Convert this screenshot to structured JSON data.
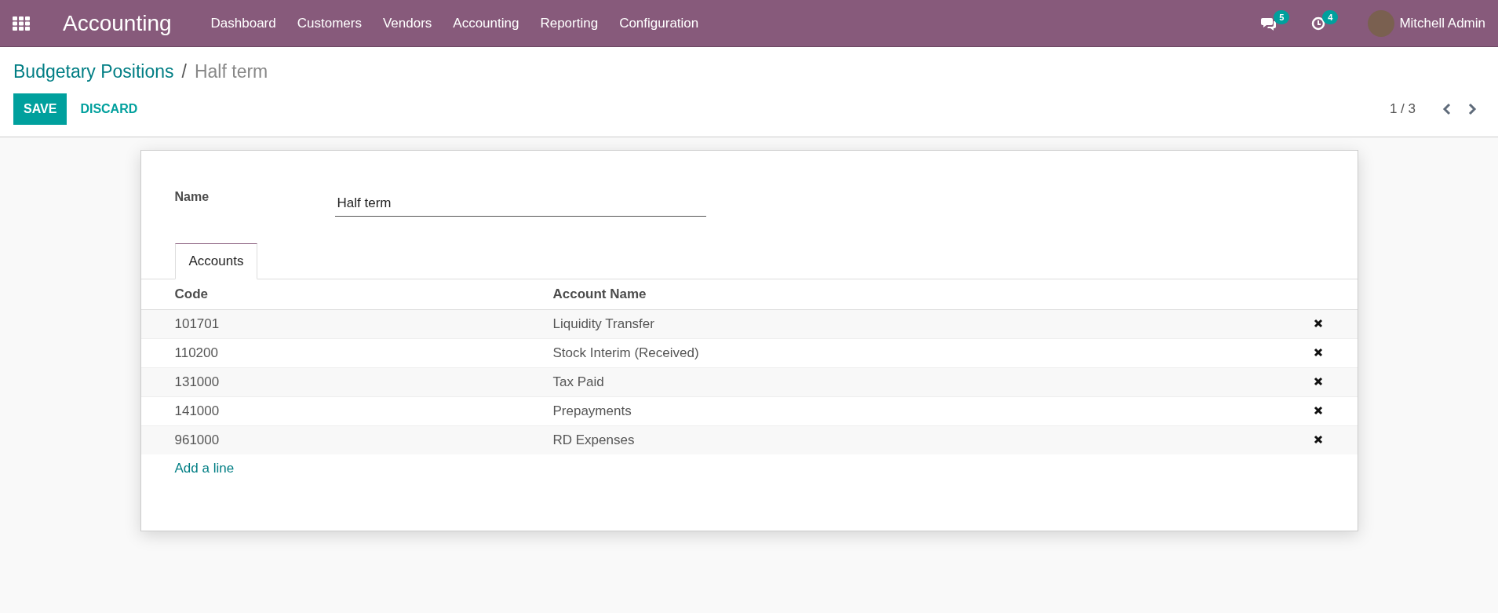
{
  "app": {
    "title": "Accounting"
  },
  "menu": [
    "Dashboard",
    "Customers",
    "Vendors",
    "Accounting",
    "Reporting",
    "Configuration"
  ],
  "systray": {
    "messages_count": "5",
    "activities_count": "4",
    "user": "Mitchell Admin"
  },
  "breadcrumb": {
    "parent": "Budgetary Positions",
    "separator": "/",
    "current": "Half term"
  },
  "buttons": {
    "save": "SAVE",
    "discard": "DISCARD"
  },
  "pager": {
    "value": "1 / 3"
  },
  "form": {
    "name_label": "Name",
    "name_value": "Half term"
  },
  "tabs": [
    {
      "label": "Accounts",
      "selected": true
    }
  ],
  "table": {
    "columns": [
      "Code",
      "Account Name"
    ],
    "rows": [
      {
        "code": "101701",
        "account_name": "Liquidity Transfer"
      },
      {
        "code": "110200",
        "account_name": "Stock Interim (Received)"
      },
      {
        "code": "131000",
        "account_name": "Tax Paid"
      },
      {
        "code": "141000",
        "account_name": "Prepayments"
      },
      {
        "code": "961000",
        "account_name": "RD Expenses"
      }
    ],
    "add_line": "Add a line"
  }
}
